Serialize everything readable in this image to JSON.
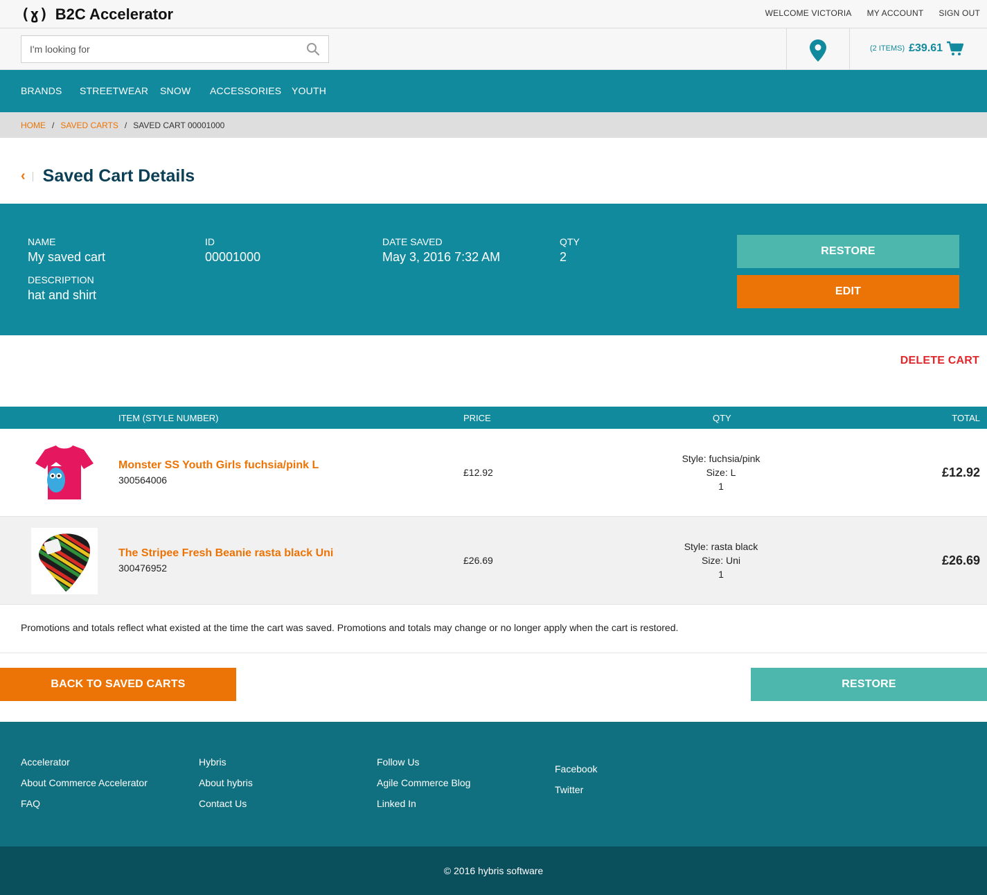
{
  "header": {
    "logo_mark": "(ɣ)",
    "logo_text": "B2C Accelerator",
    "links": [
      "WELCOME VICTORIA",
      "MY ACCOUNT",
      "SIGN OUT"
    ]
  },
  "search": {
    "placeholder": "I'm looking for"
  },
  "minicart": {
    "items": "(2 ITEMS)",
    "amount": "£39.61"
  },
  "nav": {
    "items": [
      "BRANDS",
      "STREETWEAR",
      "SNOW",
      "ACCESSORIES",
      "YOUTH"
    ]
  },
  "breadcrumb": {
    "home": "HOME",
    "saved_carts": "SAVED CARTS",
    "current": "SAVED CART 00001000",
    "sep": "/"
  },
  "page": {
    "title": "Saved Cart Details",
    "back_glyph": "‹"
  },
  "details": {
    "name_label": "NAME",
    "name_value": "My saved cart",
    "id_label": "ID",
    "id_value": "00001000",
    "date_label": "DATE SAVED",
    "date_value": "May 3, 2016 7:32 AM",
    "qty_label": "QTY",
    "qty_value": "2",
    "desc_label": "DESCRIPTION",
    "desc_value": "hat and shirt",
    "restore_label": "RESTORE",
    "edit_label": "EDIT"
  },
  "delete_label": "DELETE CART",
  "table": {
    "headers": {
      "item": "ITEM (STYLE NUMBER)",
      "price": "PRICE",
      "qty": "QTY",
      "total": "TOTAL"
    },
    "rows": [
      {
        "name": "Monster SS Youth Girls fuchsia/pink L",
        "code": "300564006",
        "price": "£12.92",
        "style": "Style: fuchsia/pink",
        "size": "Size: L",
        "qty": "1",
        "total": "£12.92"
      },
      {
        "name": "The Stripee Fresh Beanie rasta black Uni",
        "code": "300476952",
        "price": "£26.69",
        "style": "Style: rasta black",
        "size": "Size: Uni",
        "qty": "1",
        "total": "£26.69"
      }
    ]
  },
  "promo_note": "Promotions and totals reflect what existed at the time the cart was saved. Promotions and totals may change or no longer apply when the cart is restored.",
  "actions": {
    "back_label": "BACK TO SAVED CARTS",
    "restore_label": "RESTORE"
  },
  "footer": {
    "col1": [
      "Accelerator",
      "About Commerce Accelerator",
      "FAQ"
    ],
    "col2": [
      "Hybris",
      "About hybris",
      "Contact Us"
    ],
    "col3": [
      "Follow Us",
      "Agile Commerce Blog",
      "Linked In"
    ],
    "col4": [
      "Facebook",
      "Twitter"
    ],
    "copyright": "© 2016 hybris software"
  },
  "colors": {
    "teal": "#128a9e",
    "orange": "#ec7305",
    "restore": "#4db7ae",
    "delete": "#e0262a",
    "navy": "#0b3f55"
  }
}
